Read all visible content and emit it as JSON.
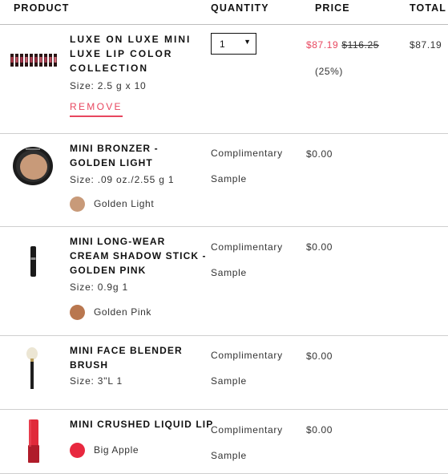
{
  "header": {
    "product": "PRODUCT",
    "quantity": "QUANTITY",
    "price": "PRICE",
    "total": "TOTAL"
  },
  "items": [
    {
      "name": "LUXE ON LUXE MINI LUXE LIP COLOR COLLECTION",
      "size": "Size: 2.5 g x 10",
      "remove": "REMOVE",
      "quantity": "1",
      "sale_price": "$87.19",
      "original_price": "$116.25",
      "discount": "(25%)",
      "total": "$87.19",
      "thumb_icon": "lipstick-set-icon"
    },
    {
      "name": "MINI BRONZER - GOLDEN LIGHT",
      "size": "Size: .09 oz./2.55 g 1",
      "shade": "Golden Light",
      "shade_color": "#c89a79",
      "quantity_text": [
        "Complimentary",
        "Sample"
      ],
      "price": "$0.00",
      "thumb_icon": "bronzer-compact-icon"
    },
    {
      "name": "MINI LONG-WEAR CREAM SHADOW STICK - GOLDEN PINK",
      "size": "Size: 0.9g 1",
      "shade": "Golden Pink",
      "shade_color": "#b9774f",
      "quantity_text": [
        "Complimentary",
        "Sample"
      ],
      "price": "$0.00",
      "thumb_icon": "shadow-stick-icon"
    },
    {
      "name": "MINI FACE BLENDER BRUSH",
      "size": "Size: 3\"L 1",
      "quantity_text": [
        "Complimentary",
        "Sample"
      ],
      "price": "$0.00",
      "thumb_icon": "makeup-brush-icon"
    },
    {
      "name": "MINI CRUSHED LIQUID LIP",
      "shade": "Big Apple",
      "shade_color": "#e8283f",
      "quantity_text": [
        "Complimentary",
        "Sample"
      ],
      "price": "$0.00",
      "thumb_icon": "liquid-lip-icon"
    }
  ],
  "colors": {
    "accent_sale": "#e8475f"
  }
}
